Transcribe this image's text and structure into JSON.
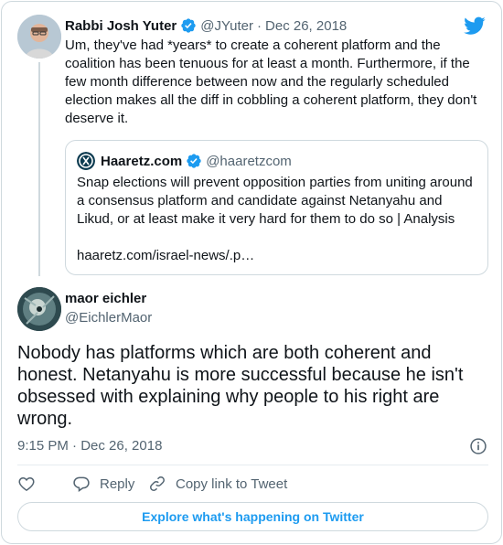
{
  "parent_tweet": {
    "author_name": "Rabbi Josh Yuter",
    "author_handle": "@JYuter",
    "separator": "·",
    "date": "Dec 26, 2018",
    "text": "Um, they've had *years* to create a coherent platform and the coalition has been tenuous for at least a month. Furthermore, if the few month difference between now and the regularly scheduled election makes all the diff in cobbling a coherent platform, they don't deserve it."
  },
  "quoted_tweet": {
    "author_name": "Haaretz.com",
    "author_handle": "@haaretzcom",
    "text": "Snap elections will prevent opposition parties from uniting around a consensus platform and candidate against Netanyahu and Likud, or at least make it very hard for them to do so | Analysis",
    "link": "haaretz.com/israel-news/.p…"
  },
  "main_tweet": {
    "author_name": "maor eichler",
    "author_handle": "@EichlerMaor",
    "text": "Nobody has platforms which are both coherent and honest.  Netanyahu is more successful because he isn't obsessed with explaining why people to his right are wrong.",
    "timestamp": "9:15 PM · Dec 26, 2018"
  },
  "actions": {
    "reply_label": "Reply",
    "copy_label": "Copy link to Tweet"
  },
  "explore_label": "Explore what's happening on Twitter",
  "colors": {
    "accent": "#1d9bf0",
    "text": "#0f1419",
    "secondary": "#536471",
    "border": "#cfd9de"
  },
  "icons": [
    "twitter-logo-icon",
    "verified-badge-icon",
    "info-icon",
    "heart-icon",
    "reply-icon",
    "link-icon"
  ]
}
